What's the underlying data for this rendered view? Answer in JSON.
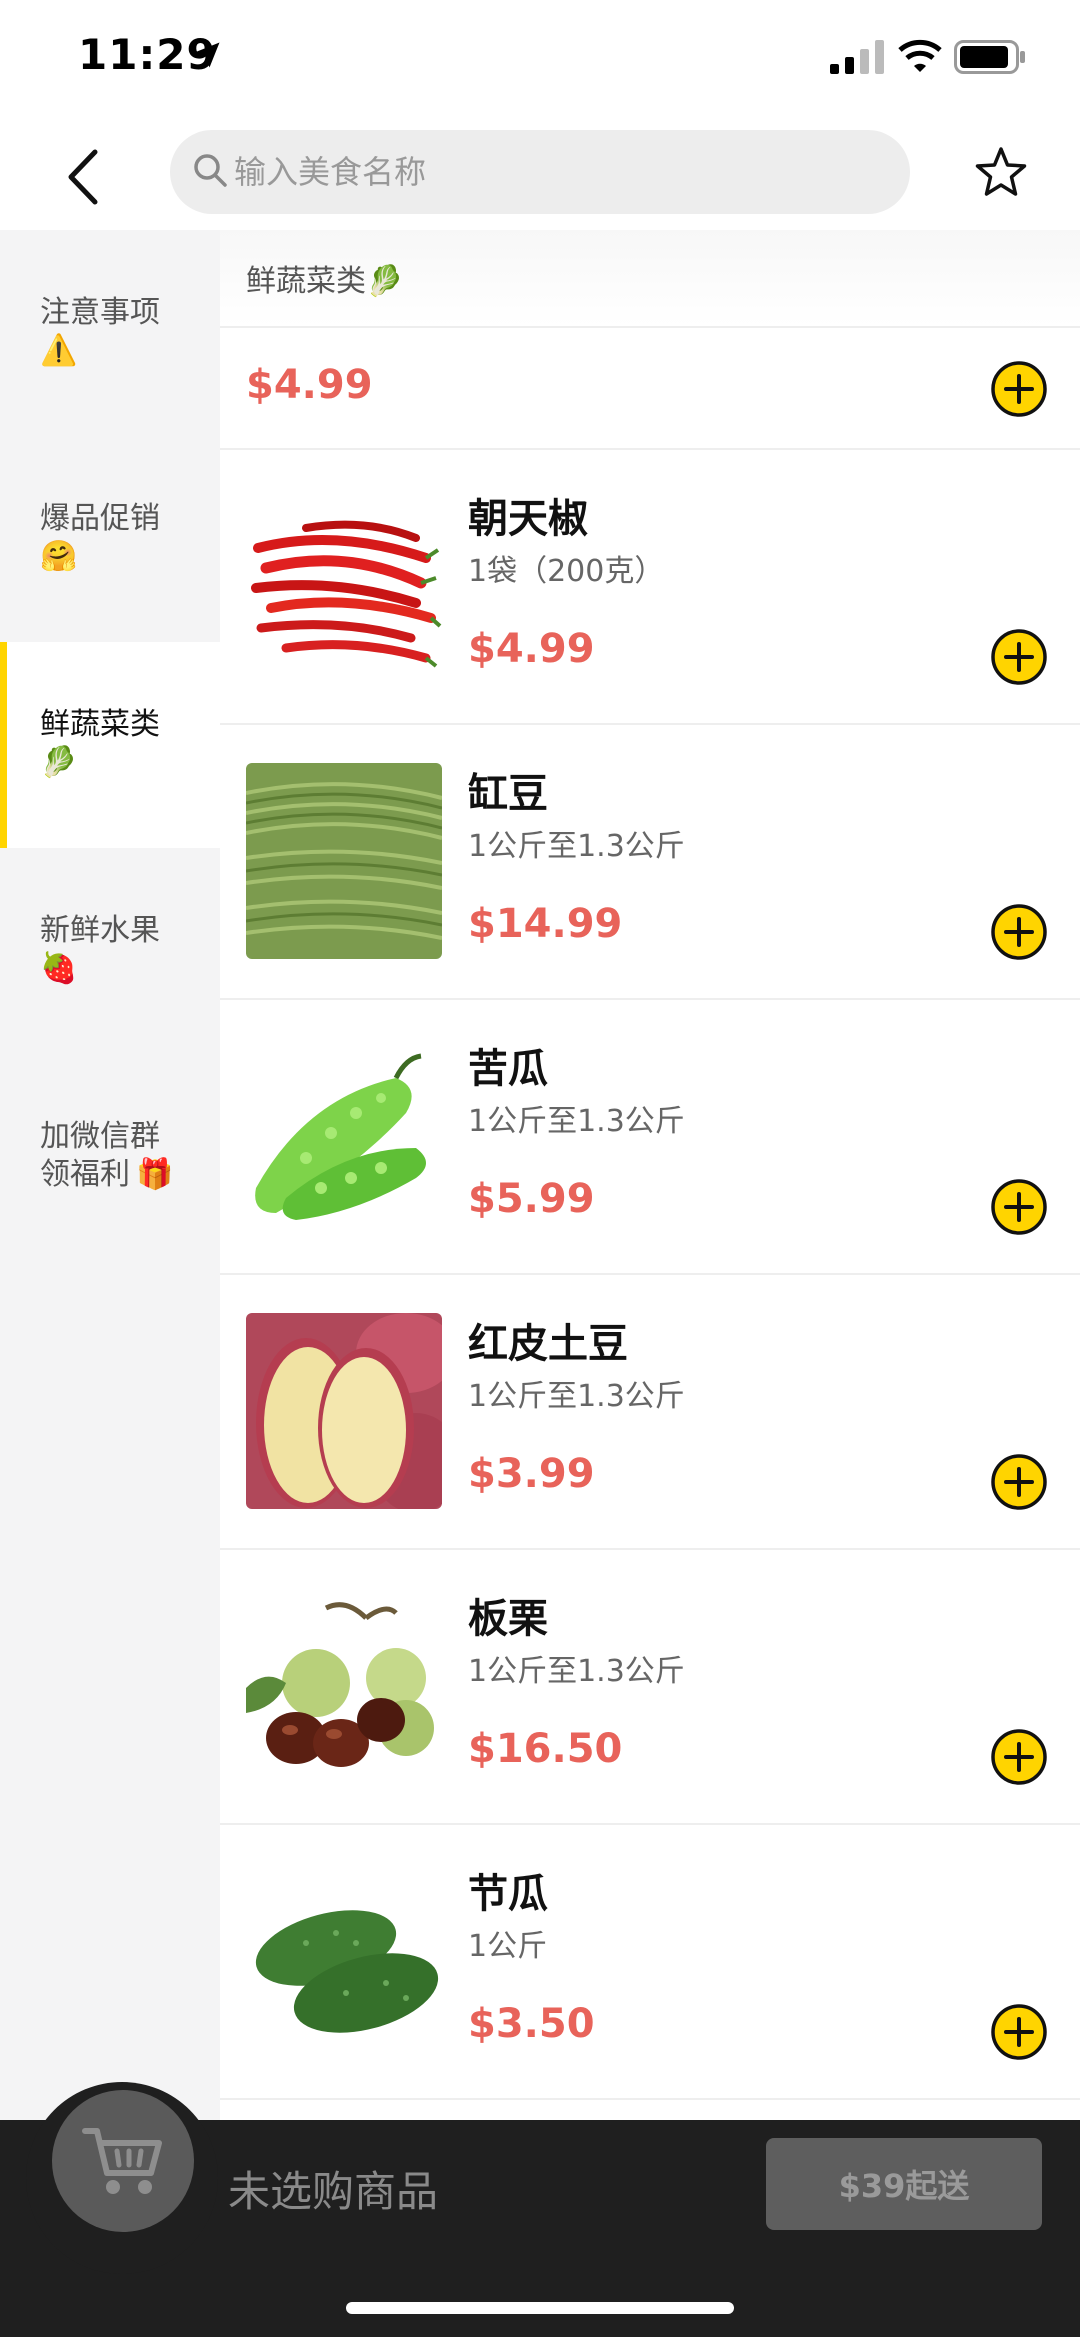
{
  "status_bar": {
    "time": "11:29"
  },
  "search": {
    "placeholder": "输入美食名称",
    "value": ""
  },
  "sidebar": {
    "items": [
      {
        "label": "注意事项",
        "emoji": "⚠️"
      },
      {
        "label": "爆品促销",
        "emoji": "🤗"
      },
      {
        "label": "鲜蔬菜类",
        "emoji": "🥬"
      },
      {
        "label": "新鲜水果",
        "emoji": "🍓"
      },
      {
        "label": "加微信群\n领福利",
        "emoji": "🎁"
      }
    ],
    "active_index": 2
  },
  "section": {
    "title": "鲜蔬菜类🥬"
  },
  "partial_item": {
    "price": "$4.99"
  },
  "products": [
    {
      "name": "朝天椒",
      "spec": "1袋（200克）",
      "price": "$4.99",
      "image": "red-chili-peppers"
    },
    {
      "name": "缸豆",
      "spec": "1公斤至1.3公斤",
      "price": "$14.99",
      "image": "long-beans"
    },
    {
      "name": "苦瓜",
      "spec": "1公斤至1.3公斤",
      "price": "$5.99",
      "image": "bitter-melon"
    },
    {
      "name": "红皮土豆",
      "spec": "1公斤至1.3公斤",
      "price": "$3.99",
      "image": "red-potato"
    },
    {
      "name": "板栗",
      "spec": "1公斤至1.3公斤",
      "price": "$16.50",
      "image": "chestnuts"
    },
    {
      "name": "节瓜",
      "spec": "1公斤",
      "price": "$3.50",
      "image": "hairy-gourd"
    }
  ],
  "cart": {
    "status": "未选购商品",
    "checkout_label": "$39起送"
  },
  "colors": {
    "accent": "#ffd400",
    "price": "#e8635a",
    "cart_bar": "#1f1f1f"
  }
}
